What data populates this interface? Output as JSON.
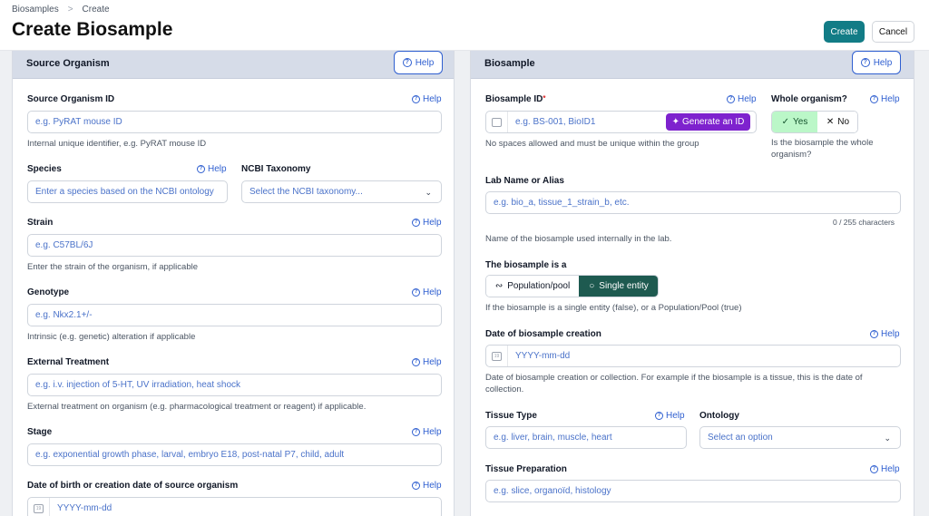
{
  "breadcrumb": {
    "parent": "Biosamples",
    "separator": ">",
    "current": "Create"
  },
  "page": {
    "title": "Create Biosample"
  },
  "actions": {
    "create": "Create",
    "cancel": "Cancel"
  },
  "help_label": "Help",
  "help_icon_glyph": "?",
  "colors": {
    "primary": "#127c86",
    "link": "#2f5fd0",
    "generate": "#7e22ce",
    "selected_segment": "#1e5a50",
    "yes_bg": "#bbf7c8",
    "panel_header": "#d6dce8"
  },
  "source_organism": {
    "title": "Source Organism",
    "id_field": {
      "label": "Source Organism ID",
      "placeholder": "e.g. PyRAT mouse ID",
      "hint": "Internal unique identifier, e.g. PyRAT mouse ID"
    },
    "species": {
      "label": "Species",
      "placeholder": "Enter a species based on the NCBI ontology"
    },
    "ncbi_taxonomy": {
      "label": "NCBI Taxonomy",
      "placeholder": "Select the NCBI taxonomy..."
    },
    "strain": {
      "label": "Strain",
      "placeholder": "e.g. C57BL/6J",
      "hint": "Enter the strain of the organism, if applicable"
    },
    "genotype": {
      "label": "Genotype",
      "placeholder": "e.g. Nkx2.1+/-",
      "hint": "Intrinsic (e.g. genetic) alteration if applicable"
    },
    "external_treatment": {
      "label": "External Treatment",
      "placeholder": "e.g. i.v. injection of 5-HT, UV irradiation, heat shock",
      "hint": "External treatment on organism (e.g. pharmacological treatment or reagent) if applicable."
    },
    "stage": {
      "label": "Stage",
      "placeholder": "e.g. exponential growth phase, larval, embryo E18, post-natal P7, child, adult"
    },
    "date_of_birth": {
      "label": "Date of birth or creation date of source organism",
      "placeholder": "YYYY-mm-dd",
      "calendar_text": "19"
    }
  },
  "biosample": {
    "title": "Biosample",
    "id_field": {
      "label": "Biosample ID",
      "required_mark": "*",
      "placeholder": "e.g. BS-001, BioID1",
      "generate_label": "Generate an ID",
      "hint": "No spaces allowed and must be unique within the group"
    },
    "whole_organism": {
      "label": "Whole organism?",
      "yes": "Yes",
      "no": "No",
      "selected": "Yes",
      "hint": "Is the biosample the whole organism?"
    },
    "lab_name": {
      "label": "Lab Name or Alias",
      "placeholder": "e.g. bio_a, tissue_1_strain_b, etc.",
      "counter": "0 / 255 characters",
      "hint": "Name of the biosample used internally in the lab."
    },
    "biosample_is": {
      "label": "The biosample is a",
      "option_population": "Population/pool",
      "option_single": "Single entity",
      "selected": "Single entity",
      "hint": "If the biosample is a single entity (false), or a Population/Pool (true)"
    },
    "date_creation": {
      "label": "Date of biosample creation",
      "placeholder": "YYYY-mm-dd",
      "calendar_text": "19",
      "hint": "Date of biosample creation or collection. For example if the biosample is a tissue, this is the date of collection."
    },
    "tissue_type": {
      "label": "Tissue Type",
      "placeholder": "e.g. liver, brain, muscle, heart"
    },
    "ontology": {
      "label": "Ontology",
      "placeholder": "Select an option"
    },
    "tissue_preparation": {
      "label": "Tissue Preparation",
      "placeholder": "e.g. slice, organoïd, histology"
    }
  }
}
